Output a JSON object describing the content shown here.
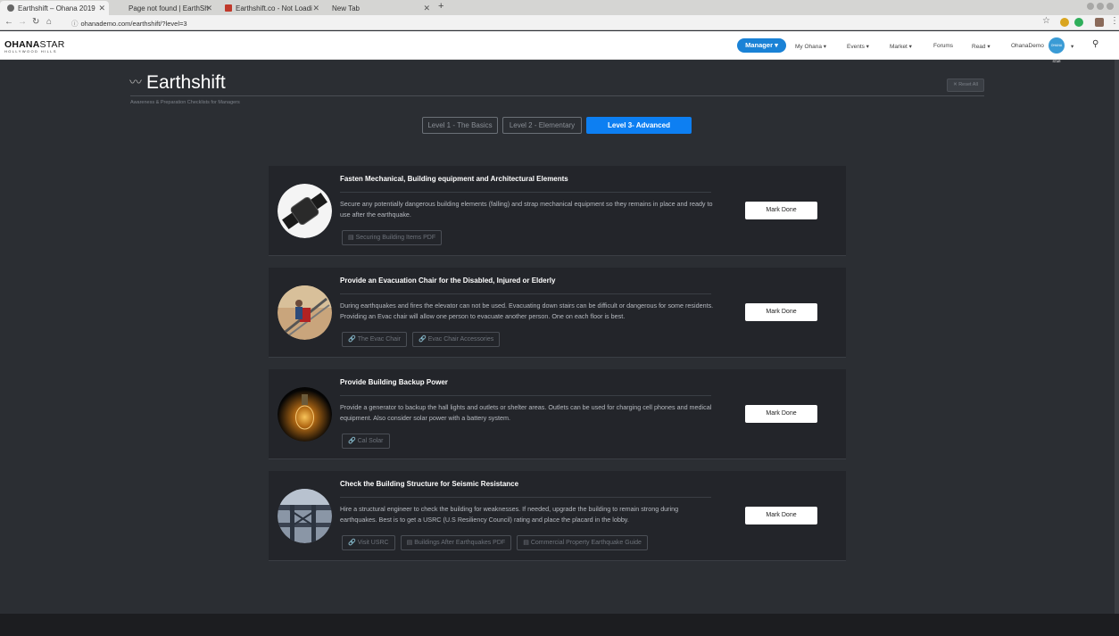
{
  "browser": {
    "tabs": [
      {
        "title": "Earthshift – Ohana 2019"
      },
      {
        "title": "Page not found | EarthSh"
      },
      {
        "title": "Earthshift.co - Not Loadi"
      },
      {
        "title": "New Tab"
      }
    ],
    "url": "ohanademo.com/earthshift/?level=3"
  },
  "site": {
    "logo_main_bold": "OHANA",
    "logo_main_thin": "STAR",
    "logo_sub": "HOLLYWOOD HILLS",
    "nav": {
      "manager": "Manager ▾",
      "my_ohana": "My Ohana ▾",
      "events": "Events ▾",
      "market": "Market ▾",
      "forums": "Forums",
      "read": "Read ▾",
      "user": "OhanaDemo",
      "avatar_text": "OHANA STAR"
    }
  },
  "page": {
    "title": "Earthshift",
    "subtitle": "Awareness & Preparation Checklists for Managers",
    "reset": "✕ Reset All",
    "levels": [
      {
        "label": "Level 1 - The Basics"
      },
      {
        "label": "Level 2 - Elementary"
      },
      {
        "label": "Level 3- Advanced"
      }
    ]
  },
  "cards": [
    {
      "title": "Fasten Mechanical, Building equipment and Architectural Elements",
      "desc": "Secure any potentially dangerous building elements (falling) and strap mechanical equipment so they remains in place and ready to use after the earthquake.",
      "links": [
        {
          "icon": "▤",
          "label": "Securing Building Items PDF"
        }
      ],
      "button": "Mark Done"
    },
    {
      "title": "Provide an Evacuation Chair for the Disabled, Injured or Elderly",
      "desc": "During earthquakes and fires the elevator can not be used. Evacuating down stairs can be difficult or dangerous for some residents. Providing an Evac chair will allow one person to evacuate another person. One on each floor is best.",
      "links": [
        {
          "icon": "🔗",
          "label": "The Evac Chair"
        },
        {
          "icon": "🔗",
          "label": "Evac Chair Accessories"
        }
      ],
      "button": "Mark Done"
    },
    {
      "title": "Provide Building Backup Power",
      "desc": "Provide a generator to backup the hall lights and outlets or shelter areas. Outlets can be used for charging cell phones and medical equipment. Also consider solar power with a battery system.",
      "links": [
        {
          "icon": "🔗",
          "label": "Cal Solar"
        }
      ],
      "button": "Mark Done"
    },
    {
      "title": "Check the Building Structure for Seismic Resistance",
      "desc": "Hire a structural engineer to check the building for weaknesses. If needed, upgrade the building to remain strong during earthquakes. Best is to get a USRC (U.S Resiliency Council) rating and place the placard in the lobby.",
      "links": [
        {
          "icon": "🔗",
          "label": "Visit USRC"
        },
        {
          "icon": "▤",
          "label": "Buildings After Earthquakes PDF"
        },
        {
          "icon": "▤",
          "label": "Commercial Property Earthquake Guide"
        }
      ],
      "button": "Mark Done"
    }
  ]
}
